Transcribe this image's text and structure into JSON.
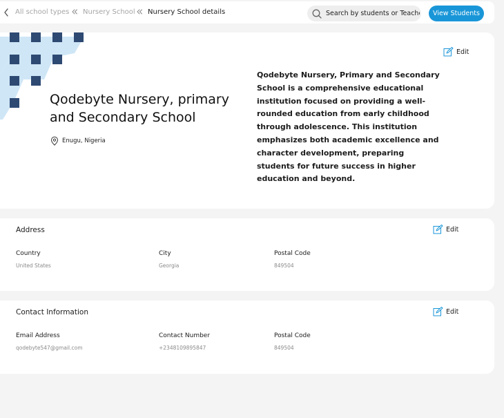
{
  "breadcrumb": {
    "items": [
      "All school types",
      "Nursery School",
      "Nursery School details"
    ]
  },
  "search": {
    "placeholder": "Search by students or Teacher"
  },
  "actions": {
    "view_students": "View Students"
  },
  "school": {
    "name": "Qodebyte Nursery, primary and Secondary School",
    "location": "Enugu, Nigeria",
    "description": "Qodebyte Nursery, Primary and Secondary School is a comprehensive educational institution focused on providing a well-rounded education from early childhood through adolescence. This institution emphasizes both academic excellence and character development, preparing students for future success in higher education and beyond.",
    "edit_label": "Edit"
  },
  "address": {
    "title": "Address",
    "edit_label": "Edit",
    "fields": [
      {
        "label": "Country",
        "value": "United States"
      },
      {
        "label": "City",
        "value": "Georgia"
      },
      {
        "label": "Postal Code",
        "value": "849504"
      }
    ]
  },
  "contact": {
    "title": "Contact Information",
    "edit_label": "Edit",
    "fields": [
      {
        "label": "Email Address",
        "value": "qodebyte547@gmail.com"
      },
      {
        "label": "Contact Number",
        "value": "+2348109895847"
      },
      {
        "label": "Postal Code",
        "value": "849504"
      }
    ]
  },
  "colors": {
    "accent": "#1996d8",
    "pattern_dark": "#2e4a73",
    "pattern_light": "#cfe6f6",
    "background": "#f4f4f4"
  },
  "icons": [
    "chevron-left-icon",
    "double-chevron-left-icon",
    "search-icon",
    "location-pin-icon",
    "edit-icon"
  ]
}
